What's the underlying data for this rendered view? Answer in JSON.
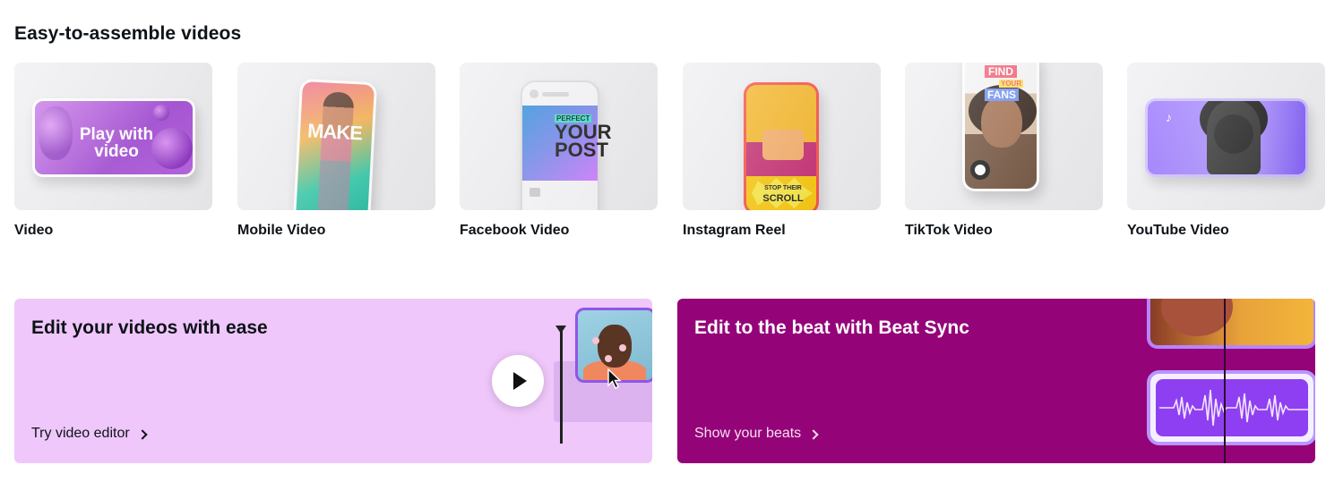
{
  "section": {
    "title": "Easy-to-assemble videos"
  },
  "tiles": [
    {
      "label": "Video",
      "thumb_text": "Play with video"
    },
    {
      "label": "Mobile Video",
      "thumb_text": "MAKE"
    },
    {
      "label": "Facebook Video",
      "thumb_tag": "PERFECT",
      "thumb_text": "YOUR POST"
    },
    {
      "label": "Instagram Reel",
      "thumb_stop": "STOP THEIR",
      "thumb_text": "SCROLL"
    },
    {
      "label": "TikTok Video",
      "thumb_find": "FIND",
      "thumb_your": "YOUR",
      "thumb_fans": "FANS"
    },
    {
      "label": "YouTube Video"
    }
  ],
  "cards": {
    "edit": {
      "title": "Edit your videos with ease",
      "link": "Try video editor",
      "bg": "#efc7fb"
    },
    "beat": {
      "title": "Edit to the beat with Beat Sync",
      "link": "Show your beats",
      "bg": "#950379"
    }
  },
  "icons": {
    "chevron": "chevron-right-icon",
    "play": "play-icon",
    "cursor": "pointer-cursor-icon",
    "music": "music-note-icon"
  }
}
